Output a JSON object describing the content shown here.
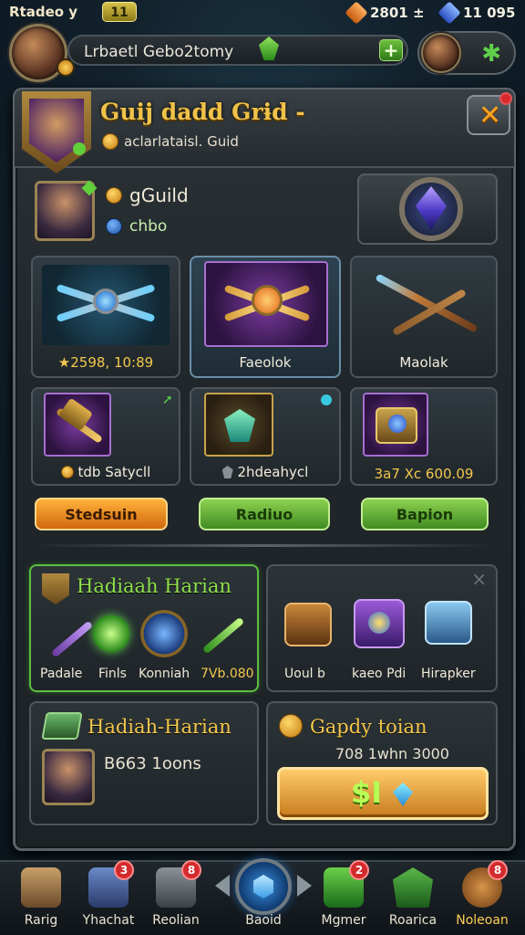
{
  "topbar": {
    "title": "Rtadeo y",
    "level": "11",
    "resource1": {
      "value": "2801 ±",
      "color": "#f08a2a",
      "icon": "orange-gem-icon"
    },
    "resource2": {
      "value": "11 095",
      "color": "#4a7ee8",
      "icon": "blue-gem-icon"
    }
  },
  "player": {
    "name": "Lrbaetl Gebo2tomy",
    "add_label": "+",
    "friend_icon": "star-icon"
  },
  "header": {
    "title": "Guij dadd Grɨd -",
    "subtitle": "aclarlataisl. Guid",
    "close_label": "✕"
  },
  "guild": {
    "name": "gGuild",
    "id": "chbo"
  },
  "weapons": [
    {
      "label": "★2598, 10:89",
      "icon": "crossbow-icon"
    },
    {
      "label": "Faeolok",
      "icon": "axe-icon"
    },
    {
      "label": "Maolak",
      "icon": "spear-icon"
    },
    {
      "label": "tdb Satycll",
      "icon": "hammer-icon"
    },
    {
      "label": "2hdeahycl",
      "icon": "shield-amulet-icon"
    },
    {
      "label": "3a7 Xc 600.09",
      "icon": "chest-icon"
    }
  ],
  "actions": {
    "btn1": "Stedsuin",
    "btn2": "Radiuo",
    "btn3": "Bapion"
  },
  "daily": {
    "title": "Hadiaah Harian",
    "items": [
      "Padale",
      "Finls",
      "Konniah",
      "7Vb.080"
    ]
  },
  "chests": {
    "close_label": "×",
    "items": [
      "Uoul b",
      "kaeo Pdi",
      "Hirapker"
    ]
  },
  "daily2": {
    "title": "Hadiah-Harian",
    "text": "B663 1oons"
  },
  "shop": {
    "title": "Gapdy toian",
    "price": "708 1whn 3000",
    "button_label": "$I"
  },
  "nav": [
    {
      "label": "Rarig",
      "badge": ""
    },
    {
      "label": "Yhachat",
      "badge": "3"
    },
    {
      "label": "Reolian",
      "badge": "8"
    },
    {
      "label": "Baoid",
      "badge": ""
    },
    {
      "label": "Mgmer",
      "badge": "2"
    },
    {
      "label": "Roarica",
      "badge": ""
    },
    {
      "label": "Noleoan",
      "badge": "8"
    }
  ]
}
